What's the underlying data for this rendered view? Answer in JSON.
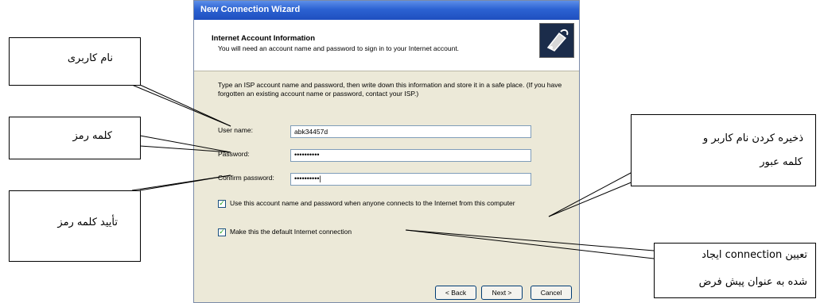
{
  "window": {
    "title": "New Connection Wizard",
    "header_title": "Internet Account Information",
    "header_subtitle": "You will need an account name and password to sign in to your Internet account.",
    "instructions": "Type an ISP account name and password, then write down this information and store it in a safe place. (If you have forgotten an existing account name or password, contact your ISP.)",
    "fields": {
      "user_name_label": "User name:",
      "user_name_value": "abk34457d",
      "password_label": "Password:",
      "password_value": "••••••••••",
      "confirm_label": "Confirm password:",
      "confirm_value": "••••••••••|"
    },
    "options": {
      "use_account": "Use this account name and password when anyone connects to the Internet from this computer",
      "make_default": "Make this the default Internet connection"
    },
    "buttons": {
      "back": "< Back",
      "next": "Next >",
      "cancel": "Cancel"
    }
  },
  "callouts": {
    "username": "نام کاربری",
    "password": "کلمه رمز",
    "confirm": "تأیید کلمه رمز",
    "save_line1": "ذخیره کردن نام کاربر و",
    "save_line2": "کلمه عبور",
    "default_line1": "تعیین connection ایجاد",
    "default_line2": "شده به عنوان پیش فرض"
  }
}
